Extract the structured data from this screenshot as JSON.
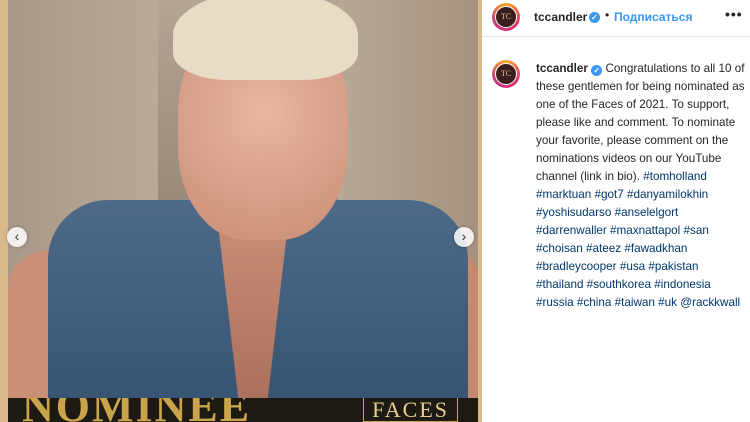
{
  "post": {
    "image_alt": "Young man with bleached hair in sleeveless denim vest",
    "banner_nominee": "NOMINEE",
    "banner_faces": "FACES",
    "prev_icon": "‹",
    "next_icon": "›"
  },
  "header": {
    "avatar_text": "TC",
    "username": "tccandler",
    "verified_icon": "✓",
    "separator": "•",
    "follow_label": "Подписаться",
    "more_icon": "•••"
  },
  "caption": {
    "avatar_text": "TC",
    "username": "tccandler",
    "verified_icon": "✓",
    "text": "Congratulations to all 10 of these gentlemen for being nominated as one of the Faces of 2021.  To support, please like and comment.  To nominate your favorite, please comment on the nominations videos on our YouTube channel (link in bio).",
    "hashtags": "#tomholland #marktuan #got7 #danyamilokhin #yoshisudarso #anselelgort #darrenwaller #maxnattapol #san #choisan #ateez #fawadkhan #bradleycooper #usa #pakistan #thailand #southkorea #indonesia #russia #china #taiwan #uk @rackkwall"
  },
  "colors": {
    "link": "#3897f0",
    "hashtag": "#00376b",
    "text": "#262626"
  }
}
